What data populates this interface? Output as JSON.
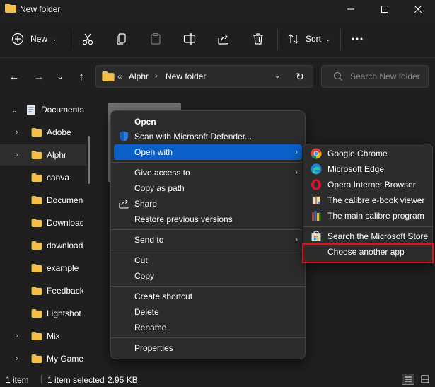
{
  "window": {
    "title": "New folder"
  },
  "toolbar": {
    "new_label": "New",
    "sort_label": "Sort"
  },
  "address": {
    "ellipsis": "«",
    "crumb1": "Alphr",
    "crumb2": "New folder",
    "sep": "›"
  },
  "search": {
    "placeholder": "Search New folder"
  },
  "sidebar": {
    "items": [
      {
        "label": "Documents"
      },
      {
        "label": "Adobe"
      },
      {
        "label": "Alphr"
      },
      {
        "label": "canva"
      },
      {
        "label": "Documents"
      },
      {
        "label": "Downloads"
      },
      {
        "label": "downloads"
      },
      {
        "label": "example"
      },
      {
        "label": "Feedback"
      },
      {
        "label": "Lightshot"
      },
      {
        "label": "Mix"
      },
      {
        "label": "My Games"
      }
    ]
  },
  "context_menu": {
    "items": [
      {
        "label": "Open"
      },
      {
        "label": "Scan with Microsoft Defender..."
      },
      {
        "label": "Open with"
      },
      {
        "label": "Give access to"
      },
      {
        "label": "Copy as path"
      },
      {
        "label": "Share"
      },
      {
        "label": "Restore previous versions"
      },
      {
        "label": "Send to"
      },
      {
        "label": "Cut"
      },
      {
        "label": "Copy"
      },
      {
        "label": "Create shortcut"
      },
      {
        "label": "Delete"
      },
      {
        "label": "Rename"
      },
      {
        "label": "Properties"
      }
    ]
  },
  "open_with_menu": {
    "items": [
      {
        "label": "Google Chrome"
      },
      {
        "label": "Microsoft Edge"
      },
      {
        "label": "Opera Internet Browser"
      },
      {
        "label": "The calibre e-book viewer"
      },
      {
        "label": "The main calibre program"
      },
      {
        "label": "Search the Microsoft Store"
      },
      {
        "label": "Choose another app"
      }
    ]
  },
  "status": {
    "count": "1 item",
    "selected": "1 item selected",
    "size": "2.95 KB"
  },
  "colors": {
    "accent": "#0a60c8",
    "highlight_box": "#e0121a",
    "folder": "#f2c04a"
  }
}
